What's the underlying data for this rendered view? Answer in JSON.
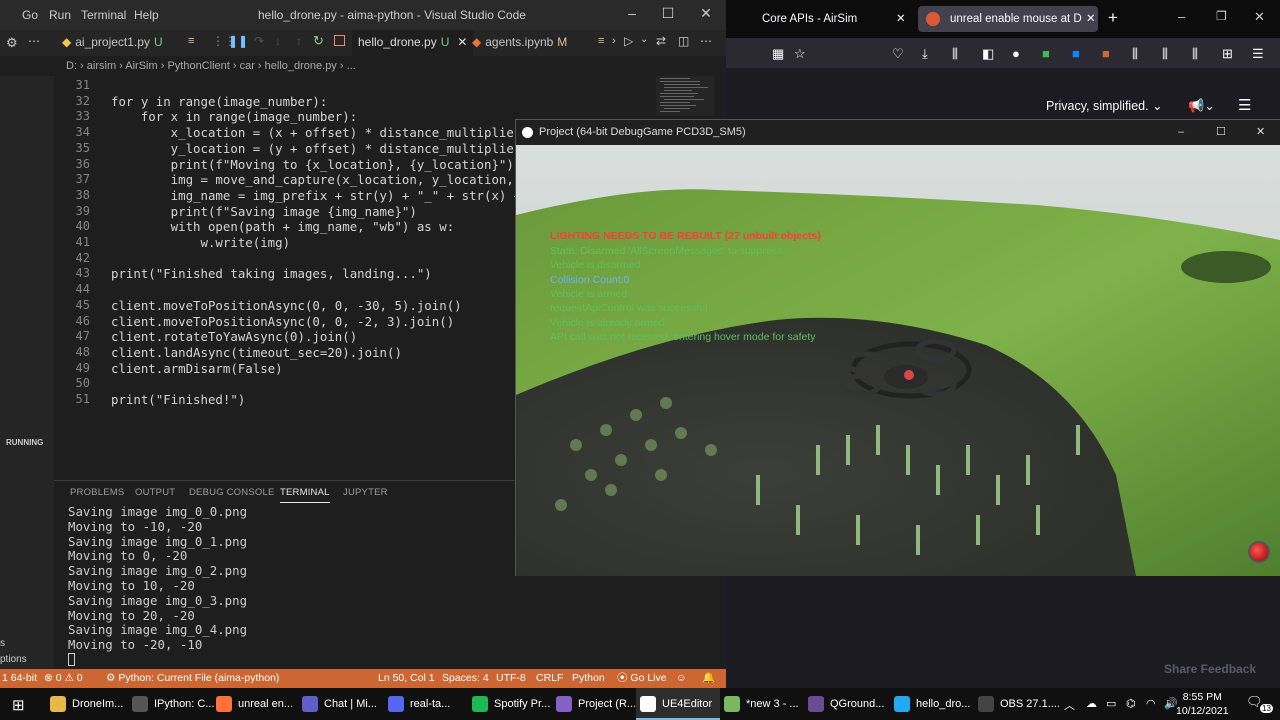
{
  "vscode": {
    "menu": [
      "Go",
      "Run",
      "Terminal",
      "Help"
    ],
    "window_title": "hello_drone.py - aima-python - Visual Studio Code",
    "tabs": [
      {
        "label": "ai_project1.py",
        "mark": "U"
      },
      {
        "label": "hello_drone.py",
        "mark": "U"
      },
      {
        "label": "agents.ipynb",
        "mark": "M"
      }
    ],
    "breadcrumb": "D: › airsim › AirSim › PythonClient › car › hello_drone.py › ...",
    "sidebar_running": "RUNNING",
    "sidebar_s": "s",
    "sidebar_options": "ptions",
    "code_lines": [
      {
        "n": "31",
        "t": ""
      },
      {
        "n": "32",
        "t": "for y in range(image_number):"
      },
      {
        "n": "33",
        "t": "    for x in range(image_number):"
      },
      {
        "n": "34",
        "t": "        x_location = (x + offset) * distance_multiplier"
      },
      {
        "n": "35",
        "t": "        y_location = (y + offset) * distance_multiplier"
      },
      {
        "n": "36",
        "t": "        print(f\"Moving to {x_location}, {y_location}\")"
      },
      {
        "n": "37",
        "t": "        img = move_and_capture(x_location, y_location, he"
      },
      {
        "n": "38",
        "t": "        img_name = img_prefix + str(y) + \"_\" + str(x) + "
      },
      {
        "n": "39",
        "t": "        print(f\"Saving image {img_name}\")"
      },
      {
        "n": "40",
        "t": "        with open(path + img_name, \"wb\") as w:"
      },
      {
        "n": "41",
        "t": "            w.write(img)"
      },
      {
        "n": "42",
        "t": ""
      },
      {
        "n": "43",
        "t": "print(\"Finished taking images, landing...\")"
      },
      {
        "n": "44",
        "t": ""
      },
      {
        "n": "45",
        "t": "client.moveToPositionAsync(0, 0, -30, 5).join()"
      },
      {
        "n": "46",
        "t": "client.moveToPositionAsync(0, 0, -2, 3).join()"
      },
      {
        "n": "47",
        "t": "client.rotateToYawAsync(0).join()"
      },
      {
        "n": "48",
        "t": "client.landAsync(timeout_sec=20).join()"
      },
      {
        "n": "49",
        "t": "client.armDisarm(False)"
      },
      {
        "n": "50",
        "t": ""
      },
      {
        "n": "51",
        "t": "print(\"Finished!\")"
      }
    ],
    "panel_tabs": [
      "PROBLEMS",
      "OUTPUT",
      "DEBUG CONSOLE",
      "TERMINAL",
      "JUPYTER"
    ],
    "terminal_lines": [
      "Saving image img_0_0.png",
      "Moving to -10, -20",
      "Saving image img_0_1.png",
      "Moving to 0, -20",
      "Saving image img_0_2.png",
      "Moving to 10, -20",
      "Saving image img_0_3.png",
      "Moving to 20, -20",
      "Saving image img_0_4.png",
      "Moving to -20, -10"
    ],
    "status": {
      "left": "1 64-bit",
      "errors": "⊗ 0 ⚠ 0",
      "launch": "Python: Current File (aima-python)",
      "position": "Ln 50, Col 1",
      "spaces": "Spaces: 4",
      "encoding": "UTF-8",
      "eol": "CRLF",
      "language": "Python",
      "golive": "Go Live"
    }
  },
  "browser": {
    "tabs": [
      "Core APIs - AirSim",
      "unreal enable mouse at DuckD"
    ],
    "privacy": "Privacy, simplified.",
    "feedback": "Share Feedback",
    "accent": "#ff3b30"
  },
  "unreal": {
    "title": "Project (64-bit DebugGame PCD3D_SM5)",
    "warning": "LIGHTING NEEDS TO BE REBUILT (27 unbuilt objects)",
    "messages": [
      "State: Disarmed  'AllScreenMessages' to suppress",
      "Vehicle is disarmed",
      "Collision Count:0",
      "Vehicle is armed",
      "requestApiControl was successful",
      "Vehicle is already armed",
      "API call was not received, entering hover mode for safety"
    ]
  },
  "taskbar": {
    "items": [
      {
        "label": "DroneIm...",
        "color": "#e8b84a"
      },
      {
        "label": "IPython: C...",
        "color": "#555"
      },
      {
        "label": "unreal en...",
        "color": "#ff7139"
      },
      {
        "label": "Chat | Mi...",
        "color": "#5b5fc7"
      },
      {
        "label": "real-ta...",
        "color": "#5865f2"
      },
      {
        "label": "Spotify Pr...",
        "color": "#1db954"
      },
      {
        "label": "Project (R...",
        "color": "#8661c5"
      },
      {
        "label": "UE4Editor",
        "color": "#ffffff"
      },
      {
        "label": "*new 3 - ...",
        "color": "#7bb661"
      },
      {
        "label": "QGround...",
        "color": "#6a4c93"
      },
      {
        "label": "hello_dro...",
        "color": "#23a9f2"
      },
      {
        "label": "OBS 27.1....",
        "color": "#444"
      }
    ],
    "time": "8:55 PM",
    "date": "10/12/2021",
    "notifications": "13"
  }
}
